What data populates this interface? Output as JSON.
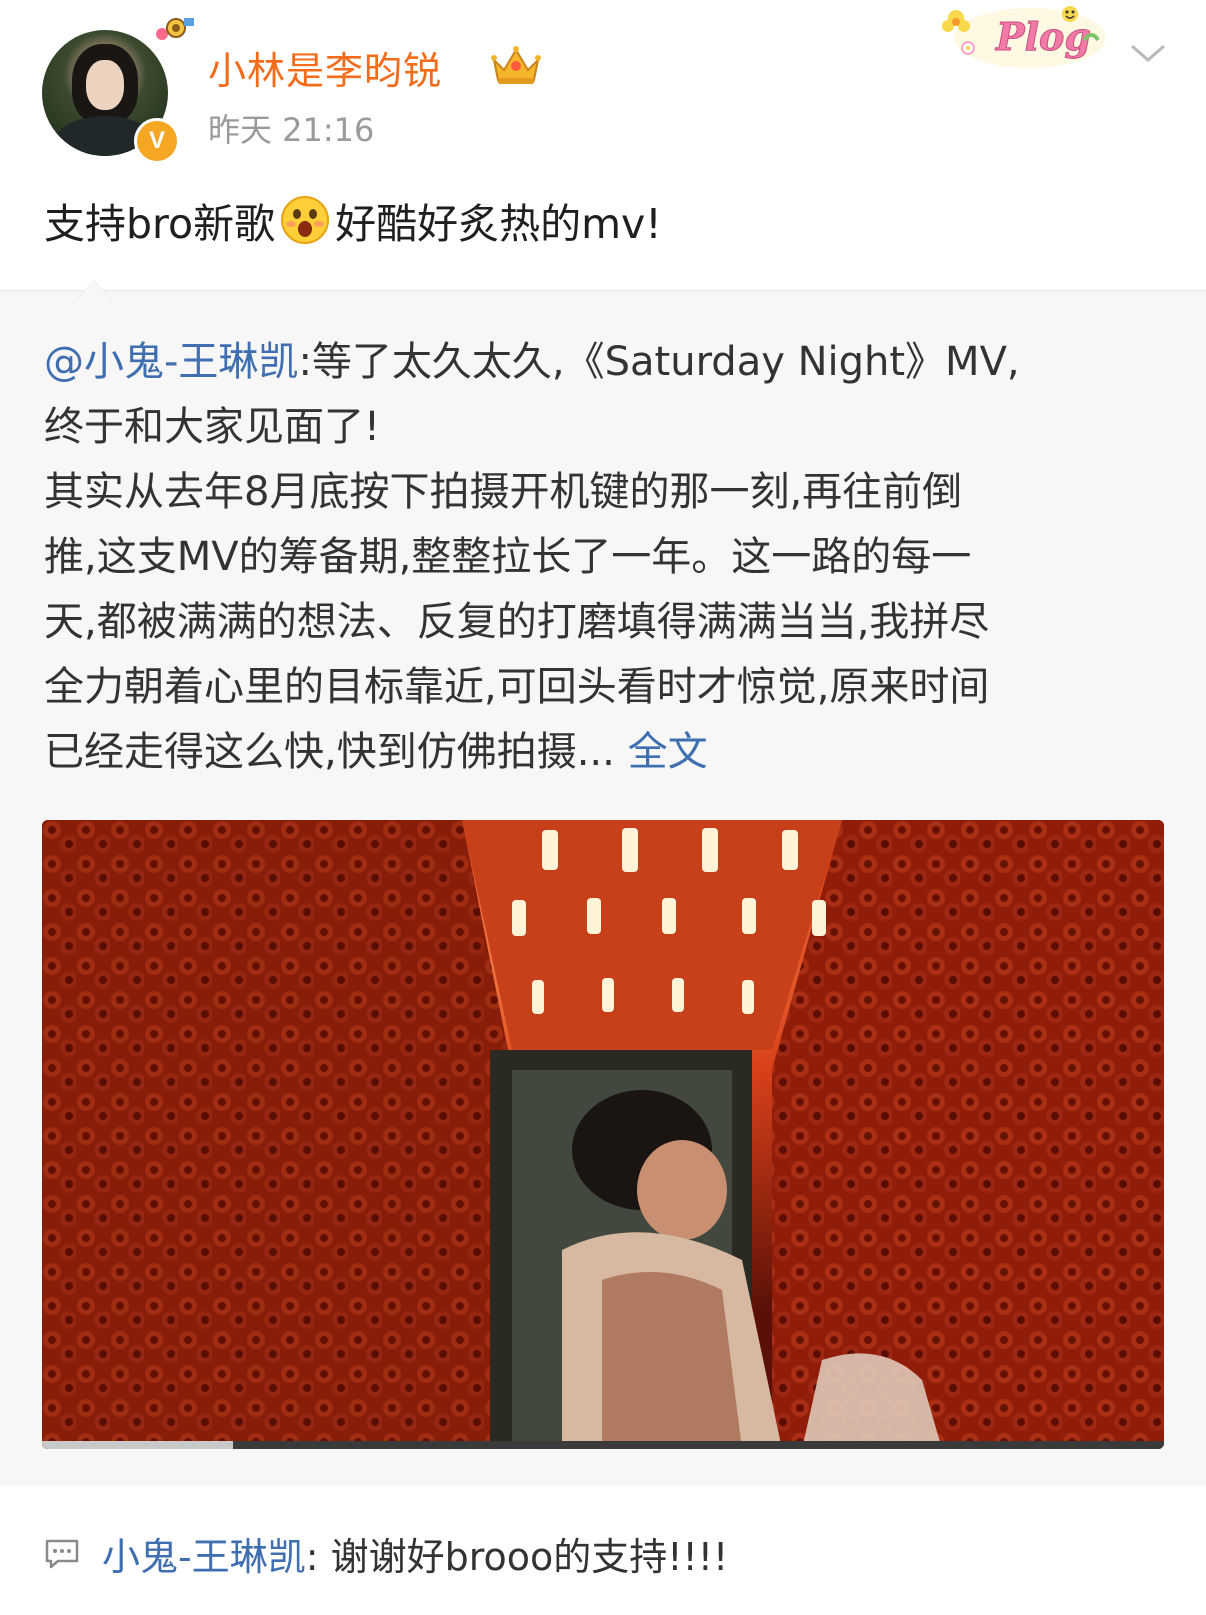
{
  "post": {
    "username": "小林是李昀锐",
    "timestamp": "昨天 21:16",
    "text_before_emoji": "支持bro新歌",
    "emoji_name": "surprised-face-emoji",
    "text_after_emoji": "好酷好炙热的mv!",
    "sticker_text": "Plog",
    "verified_badge": "V"
  },
  "repost": {
    "mention": "@小鬼-王琳凯",
    "line1_rest": ":等了太久太久,《Saturday Night》MV,",
    "line2": "终于和大家见面了!",
    "line3": "其实从去年8月底按下拍摄开机键的那一刻,再往前倒",
    "line4": "推,这支MV的筹备期,整整拉长了一年。这一路的每一",
    "line5": "天,都被满满的想法、反复的打磨填得满满当当,我拼尽",
    "line6": "全力朝着心里的目标靠近,可回头看时才惊觉,原来时间",
    "line7_text": "已经走得这么快,快到仿佛拍摄...",
    "full_text_link": " 全文"
  },
  "video": {
    "progress_fraction": 0.17
  },
  "comment": {
    "author": "小鬼-王琳凯",
    "text": ": 谢谢好brooo的支持!!!!"
  },
  "colors": {
    "username": "#f26c1b",
    "link": "#3f6fb0",
    "repost_bg": "#f7f7f7",
    "timestamp": "#9a9a9a"
  }
}
